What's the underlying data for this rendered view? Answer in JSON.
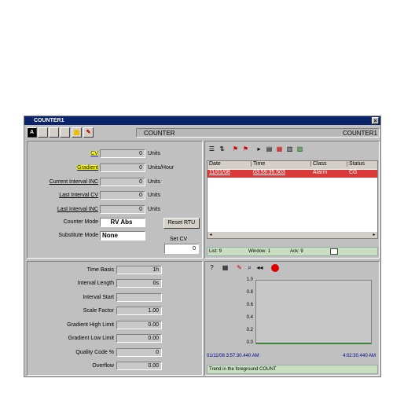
{
  "window": {
    "title": "COUNTER1",
    "close": "×"
  },
  "toolbar": {
    "btn_a": "A",
    "header_label": "COUNTER",
    "header_right": "COUNTER1"
  },
  "cv_panel": {
    "rows": [
      {
        "label": "CV",
        "value": "0",
        "unit": "Units"
      },
      {
        "label": "Gradient",
        "value": "0",
        "unit": "Units/Hour"
      },
      {
        "label": "Current Interval INC",
        "value": "0",
        "unit": "Units"
      },
      {
        "label": "Last Interval CV",
        "value": "0",
        "unit": "Units"
      },
      {
        "label": "Last Interval INC",
        "value": "0",
        "unit": "Units"
      }
    ],
    "counter_mode_label": "Counter Mode",
    "counter_mode_value": "RV Abs",
    "substitute_mode_label": "Substitute Mode",
    "substitute_mode_value": "None",
    "reset_button": "Reset RTU",
    "set_cv_label": "Set CV",
    "set_cv_value": "0"
  },
  "params_panel": {
    "rows": [
      {
        "label": "Time Basis",
        "value": "1h"
      },
      {
        "label": "Interval Length",
        "value": "0s"
      },
      {
        "label": "Interval Start",
        "value": ""
      },
      {
        "label": "Scale Factor",
        "value": "1.00"
      },
      {
        "label": "Gradient High Limit",
        "value": "0.00"
      },
      {
        "label": "Gradient Low Limit",
        "value": "0.00"
      },
      {
        "label": "Quality Code %",
        "value": "0"
      },
      {
        "label": "Overflow",
        "value": "0.00"
      }
    ]
  },
  "alarm_list": {
    "columns": [
      "Date",
      "Time",
      "Class",
      "Status"
    ],
    "rows": [
      {
        "date": "11/01/08",
        "time": "03:59:35.503",
        "class": "Alarm",
        "status": "CG"
      }
    ],
    "status_list": "List: 9",
    "status_window": "Window: 1",
    "status_ack": "Ack: 9"
  },
  "trend": {
    "y_ticks": [
      "1.0",
      "0.8",
      "0.6",
      "0.4",
      "0.2",
      "0.0"
    ],
    "x_start": "01/11/08  3:57:30.440 AM",
    "x_end": "4:02:30.440 AM",
    "status": "Trend in the foreground COUNT"
  },
  "colors": {
    "title_bar": "#0a246a",
    "selected_row": "#d83a3a",
    "panel": "#c0c0c0"
  }
}
